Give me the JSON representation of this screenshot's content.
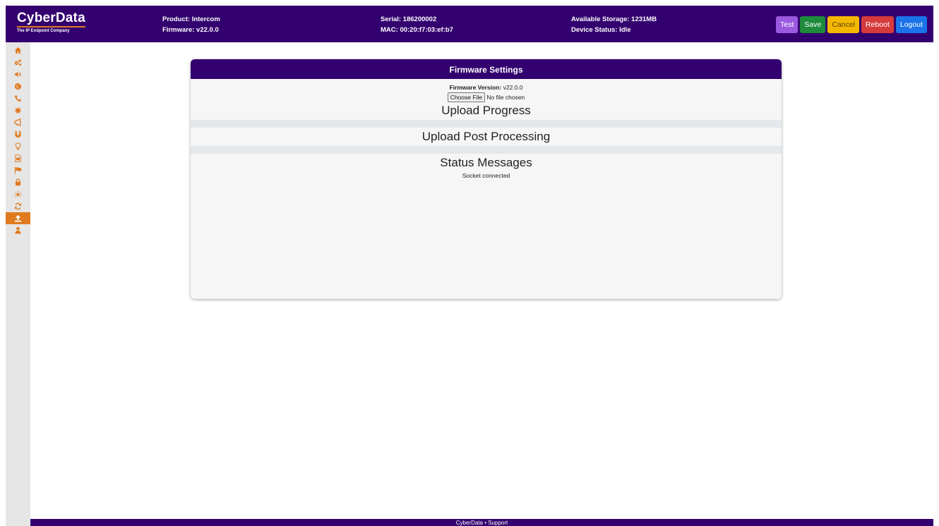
{
  "header": {
    "logo_name": "CyberData",
    "logo_sub": "The IP Endpoint Company",
    "product": "Product: Intercom",
    "firmware": "Firmware: v22.0.0",
    "serial": "Serial: 186200002",
    "mac": "MAC: 00:20:f7:03:ef:b7",
    "storage": "Available Storage: 1231MB",
    "device_status": "Device Status: Idle",
    "buttons": [
      {
        "label": "Test",
        "color": "#9b59e0"
      },
      {
        "label": "Save",
        "color": "#1e8a3c"
      },
      {
        "label": "Cancel",
        "color": "#f5b800"
      },
      {
        "label": "Reboot",
        "color": "#d63a3a"
      },
      {
        "label": "Logout",
        "color": "#1a73e8"
      }
    ]
  },
  "sidebar": {
    "items": [
      {
        "icon": "home-icon"
      },
      {
        "icon": "gears-icon"
      },
      {
        "icon": "speaker-icon"
      },
      {
        "icon": "globe-icon"
      },
      {
        "icon": "phone-icon"
      },
      {
        "icon": "burst-icon"
      },
      {
        "icon": "megaphone-icon"
      },
      {
        "icon": "magnet-icon"
      },
      {
        "icon": "lightbulb-icon"
      },
      {
        "icon": "document-icon"
      },
      {
        "icon": "flag-icon"
      },
      {
        "icon": "lock-icon"
      },
      {
        "icon": "sun-icon"
      },
      {
        "icon": "refresh-icon"
      },
      {
        "icon": "upload-icon",
        "active": true
      },
      {
        "icon": "user-icon"
      }
    ]
  },
  "card": {
    "title": "Firmware Settings",
    "fw_label": "Firmware Version:",
    "fw_value": "v22.0.0",
    "choose_file": "Choose File",
    "no_file": "No file chosen",
    "upload_progress": "Upload Progress",
    "upload_post": "Upload Post Processing",
    "status_title": "Status Messages",
    "status_msg": "Socket connected"
  },
  "footer": {
    "text": "CyberData  •  Support"
  },
  "colors": {
    "brand_purple": "#33006f",
    "accent_orange": "#e07a1f"
  }
}
